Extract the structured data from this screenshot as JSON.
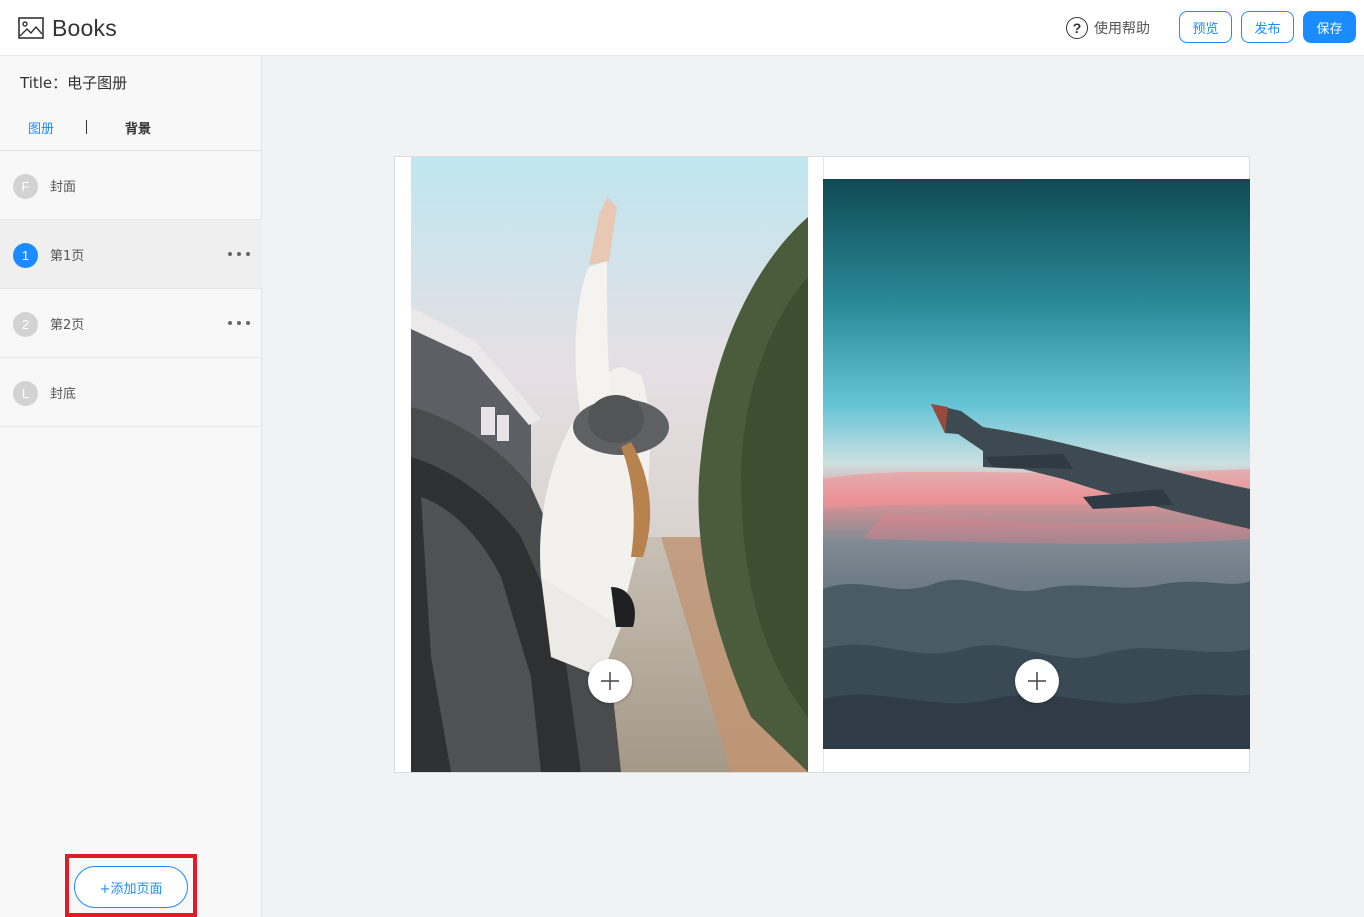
{
  "header": {
    "app_name": "Books",
    "help_label": "使用帮助",
    "preview_label": "预览",
    "publish_label": "发布",
    "save_label": "保存"
  },
  "sidebar": {
    "title": "Title：电子图册",
    "tabs": [
      "图册",
      "背景"
    ],
    "pages": [
      {
        "badge": "F",
        "label": "封面",
        "active": false,
        "has_menu": false
      },
      {
        "badge": "1",
        "label": "第1页",
        "active": true,
        "has_menu": true
      },
      {
        "badge": "2",
        "label": "第2页",
        "active": false,
        "has_menu": true
      },
      {
        "badge": "L",
        "label": "封底",
        "active": false,
        "has_menu": false
      }
    ],
    "add_page_label": "+添加页面"
  },
  "colors": {
    "accent": "#1a8cff",
    "highlight": "#e21c27"
  },
  "icons": {
    "logo": "image-icon",
    "help": "question-circle-icon",
    "menu": "more-dots-icon",
    "add_photo": "plus-icon"
  }
}
